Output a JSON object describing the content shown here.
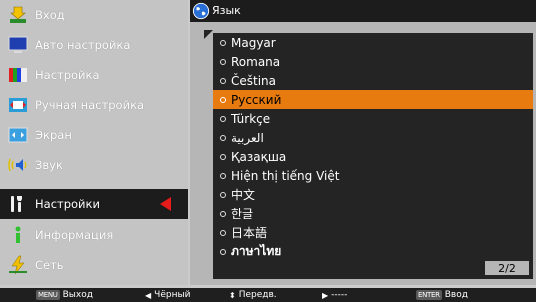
{
  "menu": {
    "items": [
      {
        "label": "Вход",
        "icon": "input-arrow-icon"
      },
      {
        "label": "Авто настройка",
        "icon": "monitor-icon"
      },
      {
        "label": "Настройка",
        "icon": "color-bars-icon"
      },
      {
        "label": "Ручная настройка",
        "icon": "manual-adjust-icon"
      },
      {
        "label": "Экран",
        "icon": "screen-icon"
      },
      {
        "label": "Звук",
        "icon": "speaker-icon"
      },
      {
        "label": "Настройки",
        "icon": "tools-icon",
        "selected": true
      },
      {
        "label": "Информация",
        "icon": "info-icon"
      },
      {
        "label": "Сеть",
        "icon": "network-icon"
      }
    ]
  },
  "panel": {
    "title": "Язык",
    "title_icon": "globe-icon",
    "languages": [
      {
        "label": "Magyar"
      },
      {
        "label": "Romana"
      },
      {
        "label": "Čeština"
      },
      {
        "label": "Русский",
        "selected": true
      },
      {
        "label": "Türkçe"
      },
      {
        "label": "العربية"
      },
      {
        "label": "Қазақша"
      },
      {
        "label": "Hiện thị tiếng Việt"
      },
      {
        "label": "中文"
      },
      {
        "label": "한글"
      },
      {
        "label": "日本語"
      },
      {
        "label": "ภาษาไทย"
      }
    ],
    "page_indicator": "2/2"
  },
  "status_bar": {
    "exit_key": "MENU",
    "exit_label": "Выход",
    "back_label": "Чёрный",
    "move_label": "Передв.",
    "next_label": "-----",
    "enter_key": "ENTER",
    "enter_label": "Ввод"
  },
  "colors": {
    "selection_orange": "#e87b10",
    "menu_selected_bg": "#1c1c1c",
    "arrow_red": "#e61b1b"
  }
}
